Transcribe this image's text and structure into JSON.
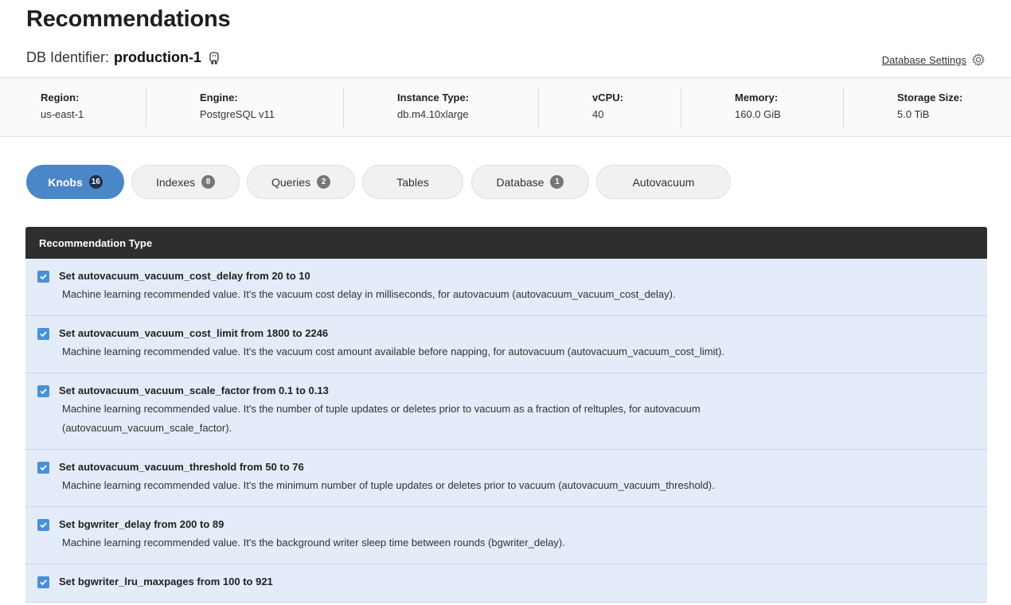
{
  "header": {
    "title": "Recommendations",
    "db_identifier_label": "DB Identifier:",
    "db_identifier_value": "production-1",
    "settings_label": "Database Settings"
  },
  "info": {
    "region_label": "Region:",
    "region_value": "us-east-1",
    "engine_label": "Engine:",
    "engine_value": "PostgreSQL v11",
    "instance_label": "Instance Type:",
    "instance_value": "db.m4.10xlarge",
    "vcpu_label": "vCPU:",
    "vcpu_value": "40",
    "memory_label": "Memory:",
    "memory_value": "160.0 GiB",
    "storage_label": "Storage Size:",
    "storage_value": "5.0 TiB"
  },
  "tabs": [
    {
      "label": "Knobs",
      "count": "16",
      "active": true
    },
    {
      "label": "Indexes",
      "count": "8",
      "active": false
    },
    {
      "label": "Queries",
      "count": "2",
      "active": false
    },
    {
      "label": "Tables",
      "count": "",
      "active": false
    },
    {
      "label": "Database",
      "count": "1",
      "active": false
    },
    {
      "label": "Autovacuum",
      "count": "",
      "active": false
    }
  ],
  "table": {
    "header": "Recommendation Type",
    "rows": [
      {
        "title": "Set autovacuum_vacuum_cost_delay from 20 to 10",
        "desc": "Machine learning recommended value. It's the vacuum cost delay in milliseconds, for autovacuum (autovacuum_vacuum_cost_delay)."
      },
      {
        "title": "Set autovacuum_vacuum_cost_limit from 1800 to 2246",
        "desc": "Machine learning recommended value. It's the vacuum cost amount available before napping, for autovacuum (autovacuum_vacuum_cost_limit)."
      },
      {
        "title": "Set autovacuum_vacuum_scale_factor from 0.1 to 0.13",
        "desc": "Machine learning recommended value. It's the number of tuple updates or deletes prior to vacuum as a fraction of reltuples, for autovacuum (autovacuum_vacuum_scale_factor)."
      },
      {
        "title": "Set autovacuum_vacuum_threshold from 50 to 76",
        "desc": "Machine learning recommended value. It's the minimum number of tuple updates or deletes prior to vacuum (autovacuum_vacuum_threshold)."
      },
      {
        "title": "Set bgwriter_delay from 200 to 89",
        "desc": "Machine learning recommended value. It's the background writer sleep time between rounds (bgwriter_delay)."
      },
      {
        "title": "Set bgwriter_lru_maxpages from 100 to 921",
        "desc": ""
      }
    ]
  },
  "colors": {
    "accent": "#4a86c8",
    "row_bg": "#e3ecf8",
    "header_bg": "#2e2e2e"
  }
}
